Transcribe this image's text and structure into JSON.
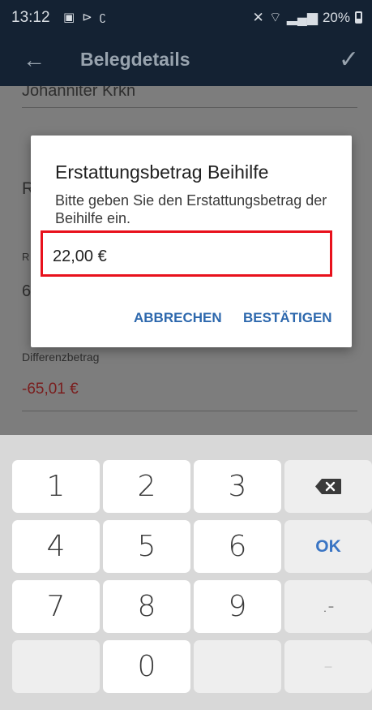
{
  "status_bar": {
    "time": "13:12",
    "battery": "20%"
  },
  "app_bar": {
    "title": "Belegdetails"
  },
  "form": {
    "field_top_value": "Johanniter Krkn",
    "field_r1_partial": "R",
    "field_r2_partial": "R",
    "field_6_partial": "6",
    "diff_label": "Differenzbetrag",
    "diff_value": "-65,01 €"
  },
  "dialog": {
    "title": "Erstattungsbetrag Beihilfe",
    "message": "Bitte geben Sie den Erstattungsbetrag der Beihilfe ein.",
    "input_value": "22,00 €",
    "cancel_label": "ABBRECHEN",
    "confirm_label": "BESTÄTIGEN"
  },
  "keyboard": {
    "k1": "1",
    "k2": "2",
    "k3": "3",
    "k4": "4",
    "k5": "5",
    "k6": "6",
    "k7": "7",
    "k8": "8",
    "k9": "9",
    "k0": "0",
    "ok": "OK",
    "sep": ".-",
    "minus": "–"
  },
  "colors": {
    "app_bar": "#142233",
    "accent": "#2d68ad",
    "highlight_border": "#e8111c",
    "negative_value": "#7a1e1e"
  }
}
